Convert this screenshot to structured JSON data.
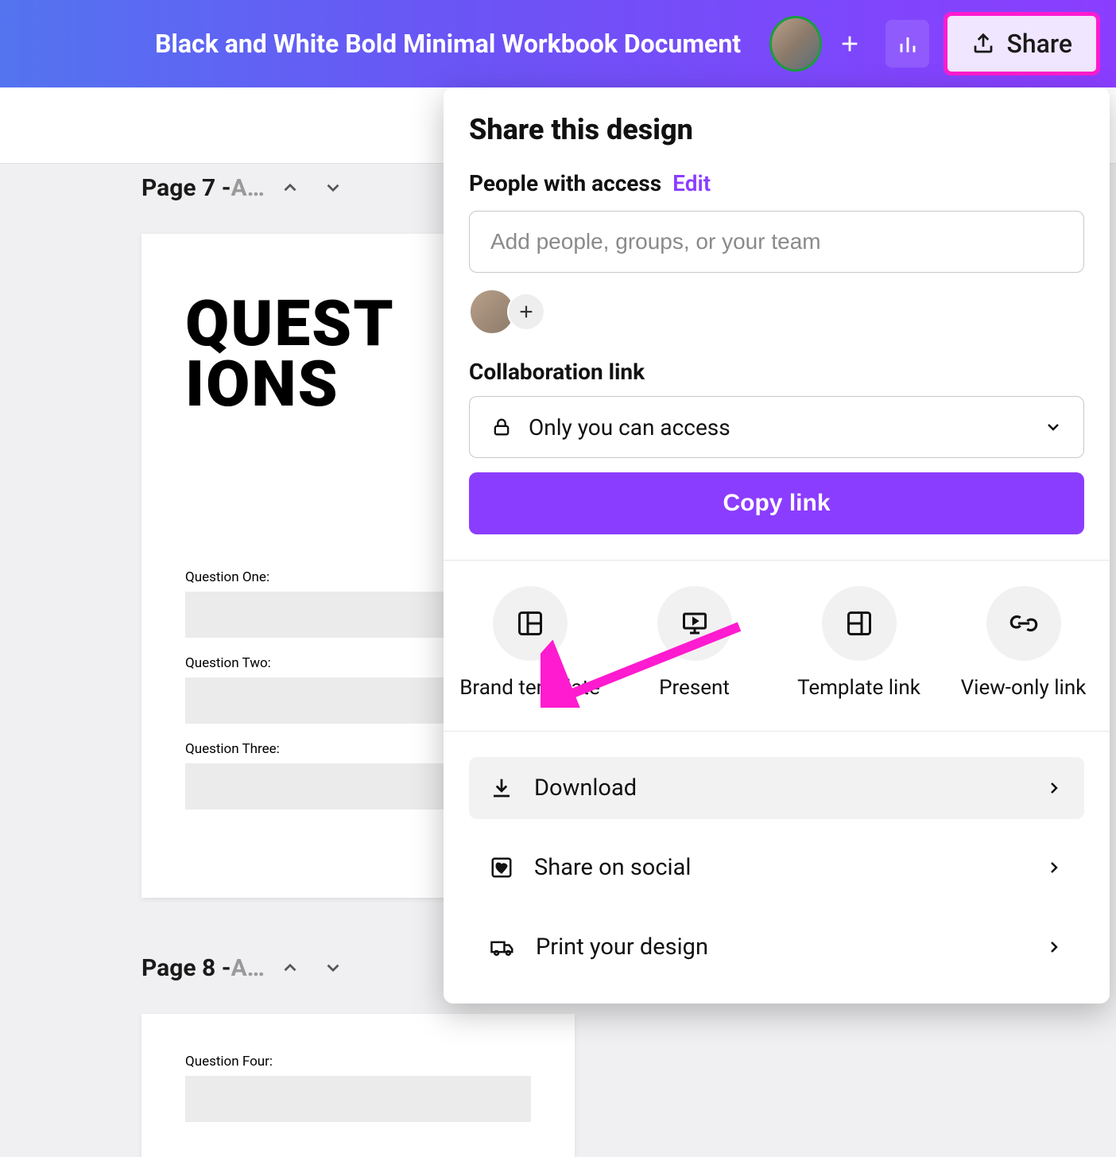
{
  "header": {
    "doc_title": "Black and White Bold Minimal Workbook Document",
    "share_label": "Share"
  },
  "pages": [
    {
      "label_prefix": "Page 7 - ",
      "label_suffix": "A…",
      "title_line1": "QUEST",
      "title_line2": "IONS",
      "questions": [
        "Question One:",
        "Question Two:",
        "Question Three:"
      ]
    },
    {
      "label_prefix": "Page 8 - ",
      "label_suffix": "A…",
      "questions": [
        "Question Four:"
      ]
    }
  ],
  "share_panel": {
    "title": "Share this design",
    "people_label": "People with access",
    "edit_label": "Edit",
    "people_placeholder": "Add people, groups, or your team",
    "collab_label": "Collaboration link",
    "collab_value": "Only you can access",
    "copy_label": "Copy link",
    "actions": [
      {
        "label": "Brand template",
        "icon": "template-icon"
      },
      {
        "label": "Present",
        "icon": "present-icon"
      },
      {
        "label": "Template link",
        "icon": "template-link-icon"
      },
      {
        "label": "View-only link",
        "icon": "view-link-icon"
      }
    ],
    "list": [
      {
        "label": "Download",
        "icon": "download-icon",
        "highlight": true
      },
      {
        "label": "Share on social",
        "icon": "heart-square-icon",
        "highlight": false
      },
      {
        "label": "Print your design",
        "icon": "truck-icon",
        "highlight": false
      }
    ]
  }
}
